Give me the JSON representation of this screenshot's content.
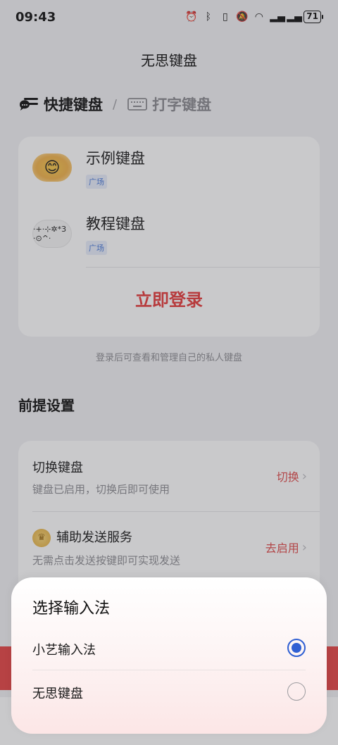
{
  "status_bar": {
    "time": "09:43",
    "icons": [
      "alarm-icon",
      "bluetooth-icon",
      "vibrate-icon",
      "mute-icon",
      "wifi-icon",
      "signal-4g-icon",
      "signal-4g-icon"
    ],
    "battery": "71"
  },
  "app": {
    "title": "无思键盘"
  },
  "tabs": [
    {
      "label": "快捷键盘",
      "active": true,
      "icon": "chat-bubble-icon"
    },
    {
      "label": "打字键盘",
      "active": false,
      "icon": "keyboard-icon"
    }
  ],
  "tab_separator": "/",
  "keyboards": [
    {
      "name": "示例键盘",
      "tag": "广场",
      "thumb": "😊"
    },
    {
      "name": "教程键盘",
      "tag": "广场",
      "thumb": "·+·⊹✲*3 ·⊙^· "
    }
  ],
  "login_button": "立即登录",
  "login_hint": "登录后可查看和管理自己的私人键盘",
  "section_title": "前提设置",
  "settings": [
    {
      "title": "切换键盘",
      "subtitle": "键盘已启用，切换后即可使用",
      "action": "切换",
      "icon": null
    },
    {
      "title": "辅助发送服务",
      "subtitle": "无需点击发送按键即可实现发送",
      "action": "去启用",
      "icon": "crown-icon"
    }
  ],
  "sheet": {
    "title": "选择输入法",
    "options": [
      {
        "label": "小艺输入法",
        "selected": true
      },
      {
        "label": "无思键盘",
        "selected": false
      }
    ]
  },
  "colors": {
    "accent_red": "#e63b3b",
    "radio_blue": "#2f5fd3",
    "tag_blue": "#4a7ad8"
  }
}
